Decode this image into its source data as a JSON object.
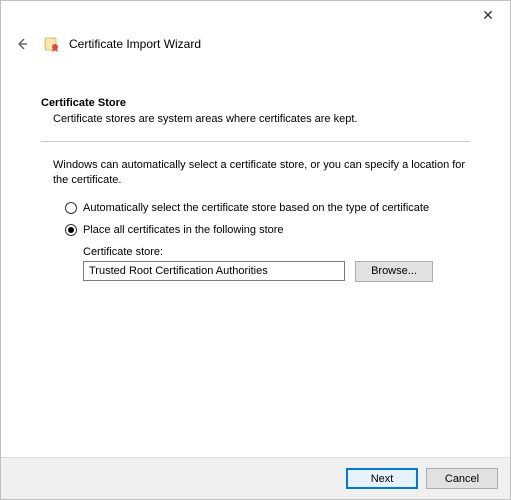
{
  "titlebar": {
    "close": "✕"
  },
  "header": {
    "title": "Certificate Import Wizard"
  },
  "section": {
    "heading": "Certificate Store",
    "sub": "Certificate stores are system areas where certificates are kept."
  },
  "body": {
    "intro": "Windows can automatically select a certificate store, or you can specify a location for the certificate."
  },
  "radios": {
    "auto": "Automatically select the certificate store based on the type of certificate",
    "place": "Place all certificates in the following store"
  },
  "store": {
    "label": "Certificate store:",
    "value": "Trusted Root Certification Authorities",
    "browse": "Browse..."
  },
  "footer": {
    "next": "Next",
    "cancel": "Cancel"
  }
}
